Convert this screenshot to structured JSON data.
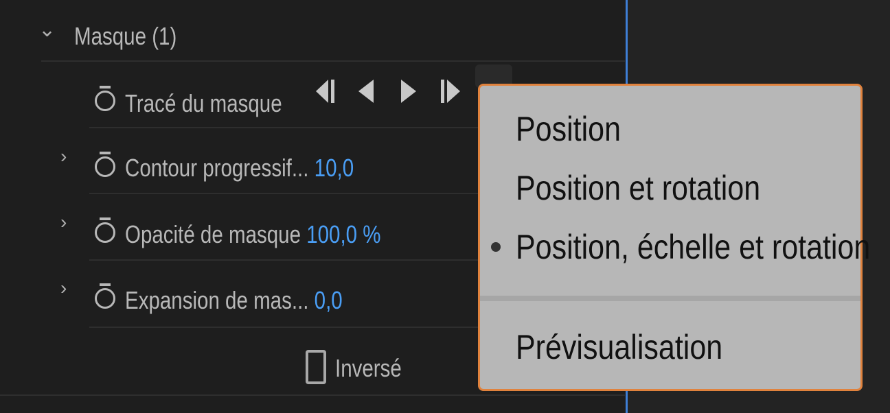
{
  "mask_group": {
    "label": "Masque (1)"
  },
  "mask_path": {
    "label": "Tracé du masque",
    "keyframe_buttons": [
      "step-back-keyframe-icon",
      "play-reverse-icon",
      "play-forward-icon",
      "step-forward-keyframe-icon"
    ]
  },
  "properties": [
    {
      "label": "Contour progressif...",
      "value": "10,0"
    },
    {
      "label": "Opacité de masque",
      "value": "100,0 %"
    },
    {
      "label": "Expansion de mas...",
      "value": "0,0"
    }
  ],
  "inverted": {
    "label": "Inversé",
    "checked": false
  },
  "context_menu": {
    "items": [
      "Position",
      "Position et rotation",
      "Position, échelle et rotation",
      "Prévisualisation"
    ],
    "selected_index": 2
  },
  "colors": {
    "accent": "#4a9ef5",
    "menu_border": "#e0823d",
    "playhead": "#3f7fd6"
  }
}
